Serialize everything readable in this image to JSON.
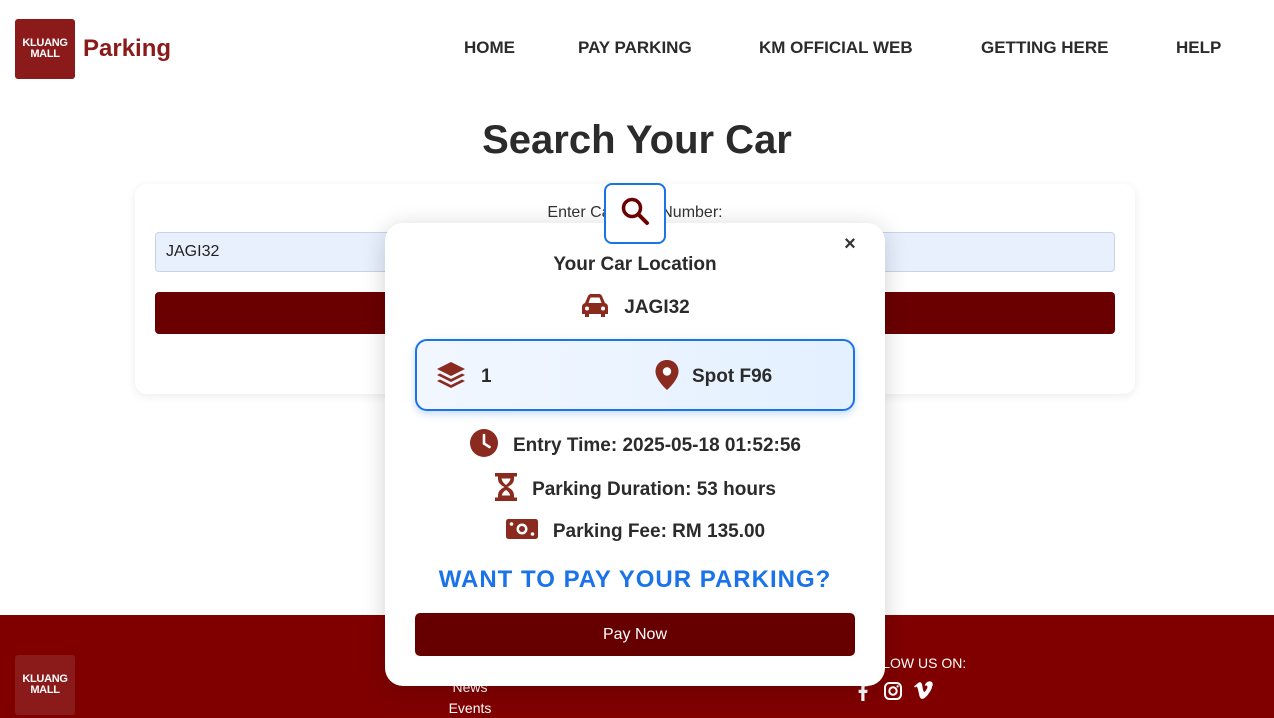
{
  "header": {
    "logo_line1": "KLUANG",
    "logo_line2": "MALL",
    "brand": "Parking",
    "nav": [
      "HOME",
      "PAY PARKING",
      "KM OFFICIAL WEB",
      "GETTING HERE",
      "HELP"
    ]
  },
  "main": {
    "title": "Search Your Car",
    "search_label": "Enter Car Plate Number:",
    "search_value": "JAGI32"
  },
  "modal": {
    "title": "Your Car Location",
    "plate": "JAGI32",
    "level": "1",
    "spot": "Spot F96",
    "entry_time": "Entry Time: 2025-05-18 01:52:56",
    "duration": "Parking Duration: 53 hours",
    "fee": "Parking Fee: RM 135.00",
    "cta": "WANT TO PAY YOUR PARKING?",
    "pay_button": "Pay Now",
    "close": "×"
  },
  "footer": {
    "logo_line1": "KLUANG",
    "logo_line2": "MALL",
    "links": [
      "News",
      "Events"
    ],
    "follow": "FOLLOW US ON:"
  },
  "colors": {
    "brand": "#8b1a1a",
    "accent_blue": "#1a73e8",
    "button_dark": "#660000",
    "footer": "#800000"
  },
  "icons": [
    "search-icon",
    "close-icon",
    "car-icon",
    "layers-icon",
    "map-pin-icon",
    "clock-icon",
    "hourglass-icon",
    "money-icon",
    "facebook-icon",
    "instagram-icon",
    "vimeo-icon"
  ]
}
